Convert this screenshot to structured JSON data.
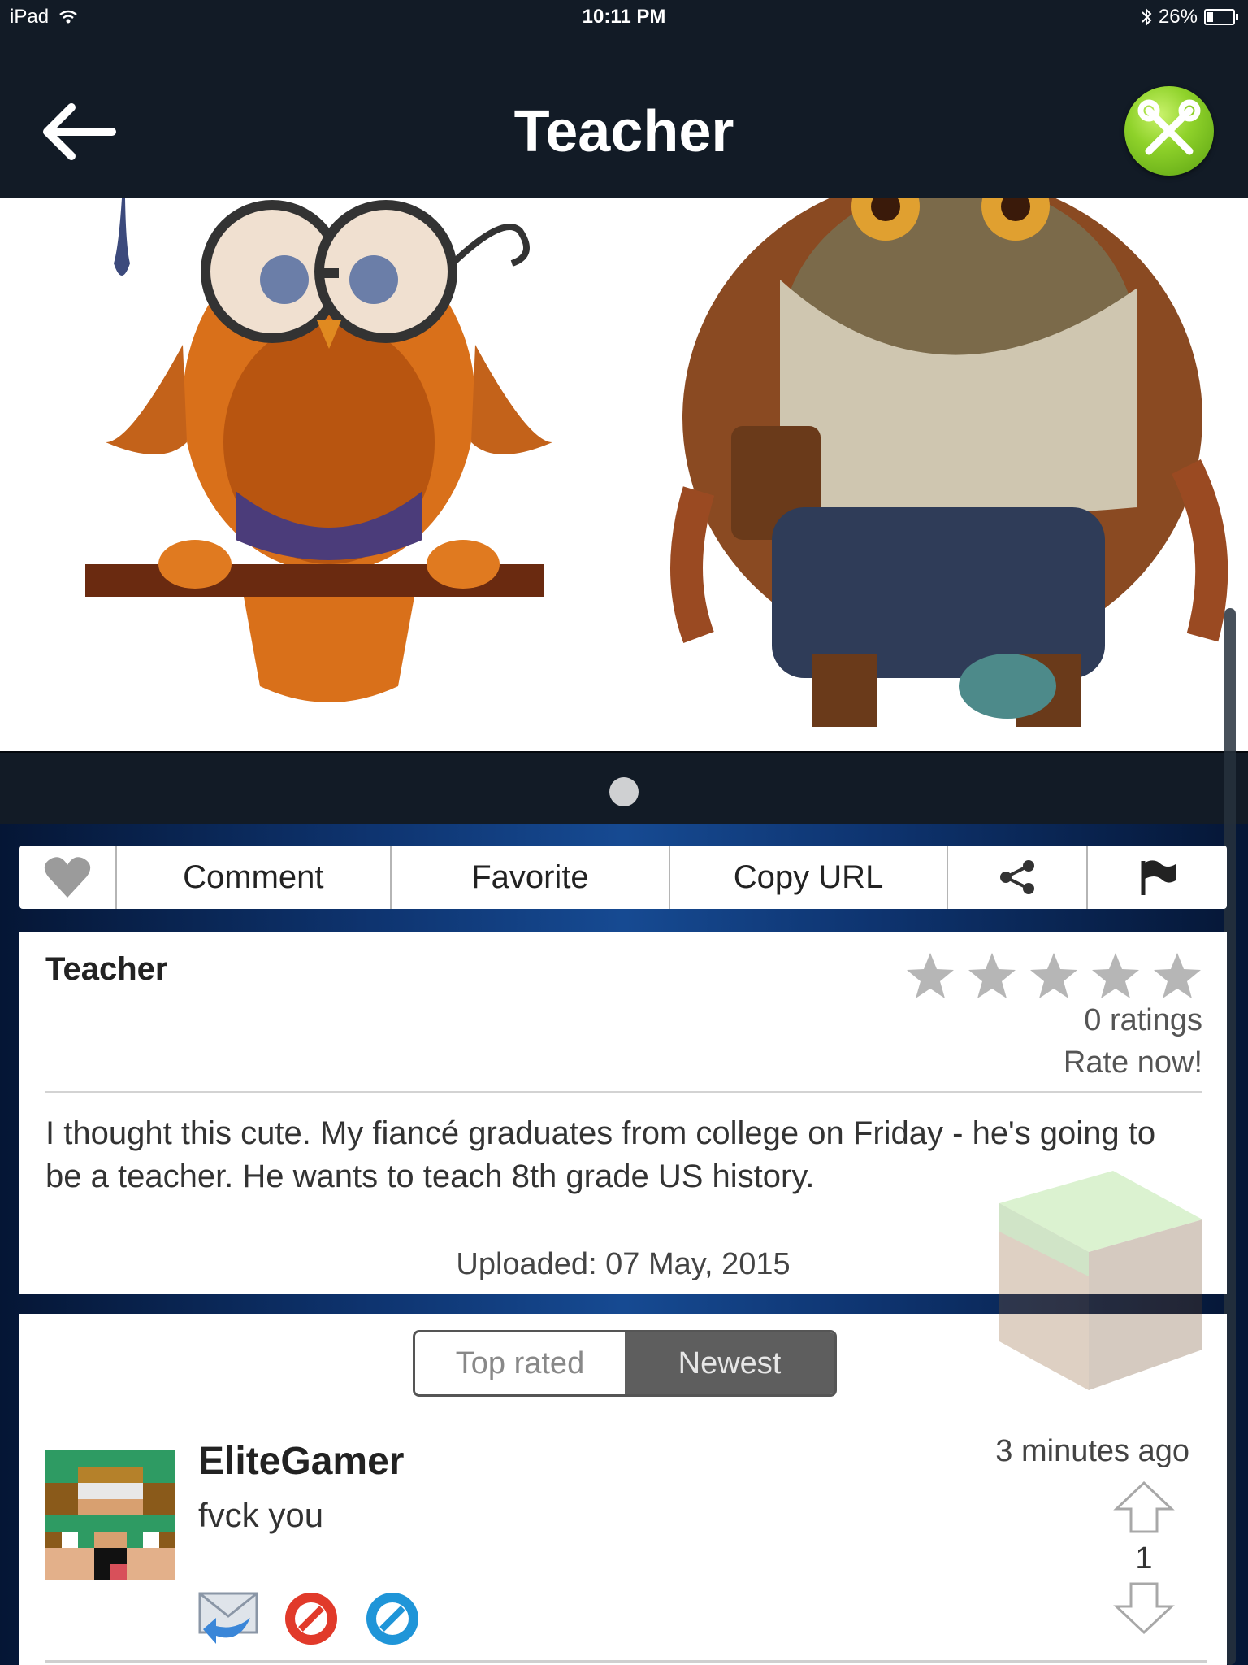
{
  "status_bar": {
    "device": "iPad",
    "time": "10:11 PM",
    "battery": "26%",
    "battery_level": 0.26
  },
  "header": {
    "title": "Teacher"
  },
  "gallery": {
    "page_count": 1,
    "current_page": 1
  },
  "action_bar": {
    "comment_label": "Comment",
    "favorite_label": "Favorite",
    "copy_url_label": "Copy URL"
  },
  "post": {
    "title": "Teacher",
    "star_count": 5,
    "ratings": "0 ratings",
    "rate_now": "Rate now!",
    "description": "I thought this cute.  My fiancé graduates from college on Friday - he's going to be a teacher.  He wants to teach 8th grade US history.",
    "uploaded": "Uploaded: 07 May, 2015"
  },
  "comments": {
    "sort_options": [
      "Top rated",
      "Newest"
    ],
    "active_sort": "Newest",
    "items": [
      {
        "user": "EliteGamer",
        "text": "fvck you",
        "time": "3 minutes ago",
        "votes": "1"
      }
    ]
  },
  "colors": {
    "header_bg": "#121b26",
    "accent_green": "#8fd22a",
    "background_blue": "#164a92"
  }
}
